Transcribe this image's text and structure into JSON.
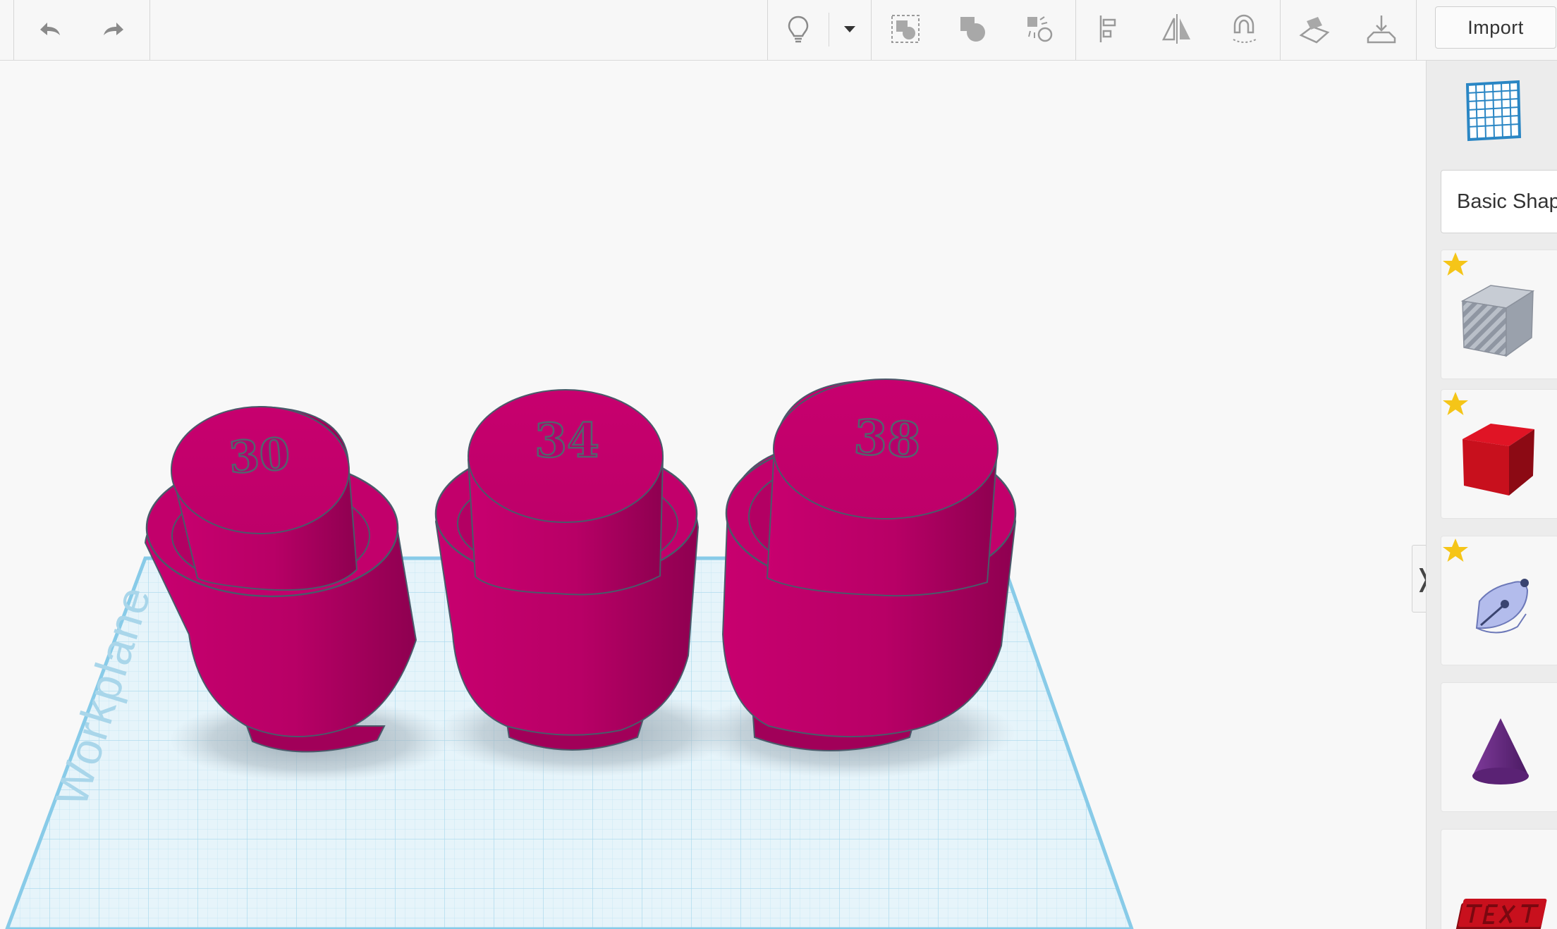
{
  "toolbar": {
    "undo_icon": "undo-arrow-icon",
    "redo_icon": "redo-arrow-icon",
    "import_label": "Import"
  },
  "panel": {
    "category_label": "Basic Shapes",
    "shapes": [
      {
        "name": "box-hole",
        "favorite": true
      },
      {
        "name": "box",
        "favorite": true,
        "color": "#c8101d"
      },
      {
        "name": "scribble",
        "favorite": true,
        "color": "#aab4e8"
      },
      {
        "name": "cone",
        "favorite": false,
        "color": "#6a2a82"
      },
      {
        "name": "text",
        "favorite": false,
        "color": "#b0101a"
      }
    ]
  },
  "workplane": {
    "label": "Workplane",
    "grid_color": "#bfe3f3",
    "border_color": "#7fc6e6"
  },
  "objects": [
    {
      "label": "30",
      "color": "#c4006c"
    },
    {
      "label": "34",
      "color": "#c4006c"
    },
    {
      "label": "38",
      "color": "#c4006c"
    }
  ],
  "colors": {
    "accent_blue": "#1f7ab8",
    "star": "#f5c518"
  }
}
